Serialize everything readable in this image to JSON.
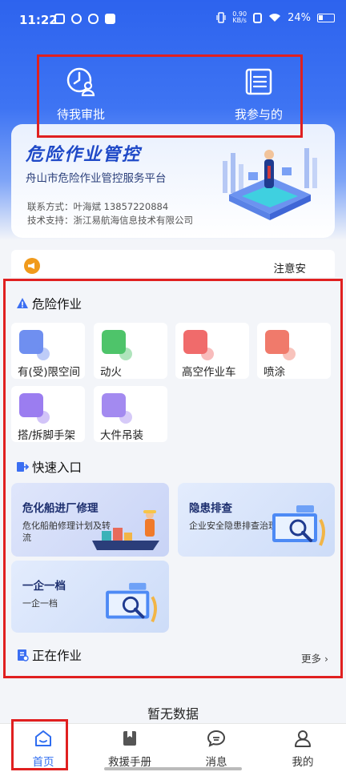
{
  "status_bar": {
    "time": "11:22",
    "net_speed_top": "0.90",
    "net_speed_bottom": "KB/s",
    "battery": "24%"
  },
  "top_actions": [
    {
      "label": "待我审批",
      "icon": "approval-icon"
    },
    {
      "label": "我参与的",
      "icon": "list-icon"
    }
  ],
  "banner": {
    "title": "危险作业管控",
    "subtitle": "舟山市危险作业管控服务平台",
    "contact": "联系方式：叶海斌 13857220884",
    "support": "技术支持：浙江易航海信息技术有限公司"
  },
  "notice": {
    "text": "注意安"
  },
  "sections": {
    "danger": "危险作业",
    "quick": "快速入口",
    "ongoing": "正在作业"
  },
  "danger_tiles": [
    {
      "label": "有(受)限空间",
      "color": "#6f8ff0"
    },
    {
      "label": "动火",
      "color": "#4ec46a"
    },
    {
      "label": "高空作业车",
      "color": "#f06b6b"
    },
    {
      "label": "喷涂",
      "color": "#f07a6b"
    },
    {
      "label": "搭/拆脚手架",
      "color": "#9b7df0"
    },
    {
      "label": "大件吊装",
      "color": "#a38af0"
    }
  ],
  "quick_cards": [
    {
      "title": "危化船进厂修理",
      "desc": "危化船舶修理计划及转流"
    },
    {
      "title": "隐患排查",
      "desc": "企业安全隐患排查治理"
    },
    {
      "title": "一企一档",
      "desc": "一企一档"
    }
  ],
  "more_label": "更多",
  "empty_text": "暂无数据",
  "tabs": [
    {
      "label": "首页"
    },
    {
      "label": "救援手册"
    },
    {
      "label": "消息"
    },
    {
      "label": "我的"
    }
  ],
  "colors": {
    "primary": "#2e6cf0",
    "highlight": "#e02020",
    "notice": "#f09a1b"
  }
}
